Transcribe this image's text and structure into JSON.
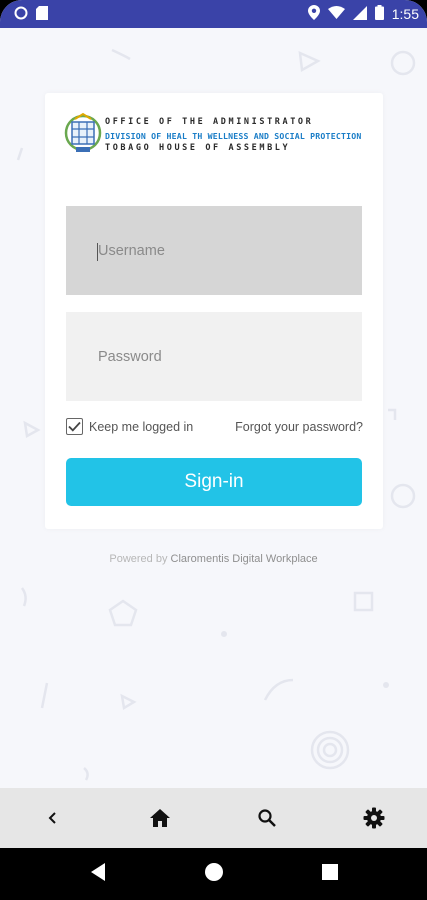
{
  "status_bar": {
    "time": "1:55",
    "icons": [
      "circle-notification-icon",
      "sd-card-icon",
      "location-icon",
      "wifi-icon",
      "signal-icon",
      "battery-icon"
    ]
  },
  "logo": {
    "line1": "OFFICE OF THE ADMINISTRATOR",
    "line2": "DIVISION OF HEAL TH WELLNESS AND SOCIAL PROTECTION",
    "line3": "TOBAGO HOUSE OF ASSEMBLY"
  },
  "form": {
    "username_placeholder": "Username",
    "password_placeholder": "Password",
    "keep_logged_in_label": "Keep me logged in",
    "keep_logged_in_checked": true,
    "forgot_password_label": "Forgot your password?",
    "signin_label": "Sign-in"
  },
  "footer": {
    "powered_prefix": "Powered by",
    "powered_link": "Claromentis Digital Workplace"
  },
  "bottom_nav": {
    "items": [
      "back-icon",
      "home-icon",
      "search-icon",
      "settings-icon"
    ]
  },
  "system_nav": [
    "back-triangle-icon",
    "home-circle-icon",
    "recents-square-icon"
  ],
  "colors": {
    "status_bar": "#3a43a8",
    "accent": "#22c3e7",
    "background": "#f6f7fb",
    "card": "#ffffff"
  }
}
